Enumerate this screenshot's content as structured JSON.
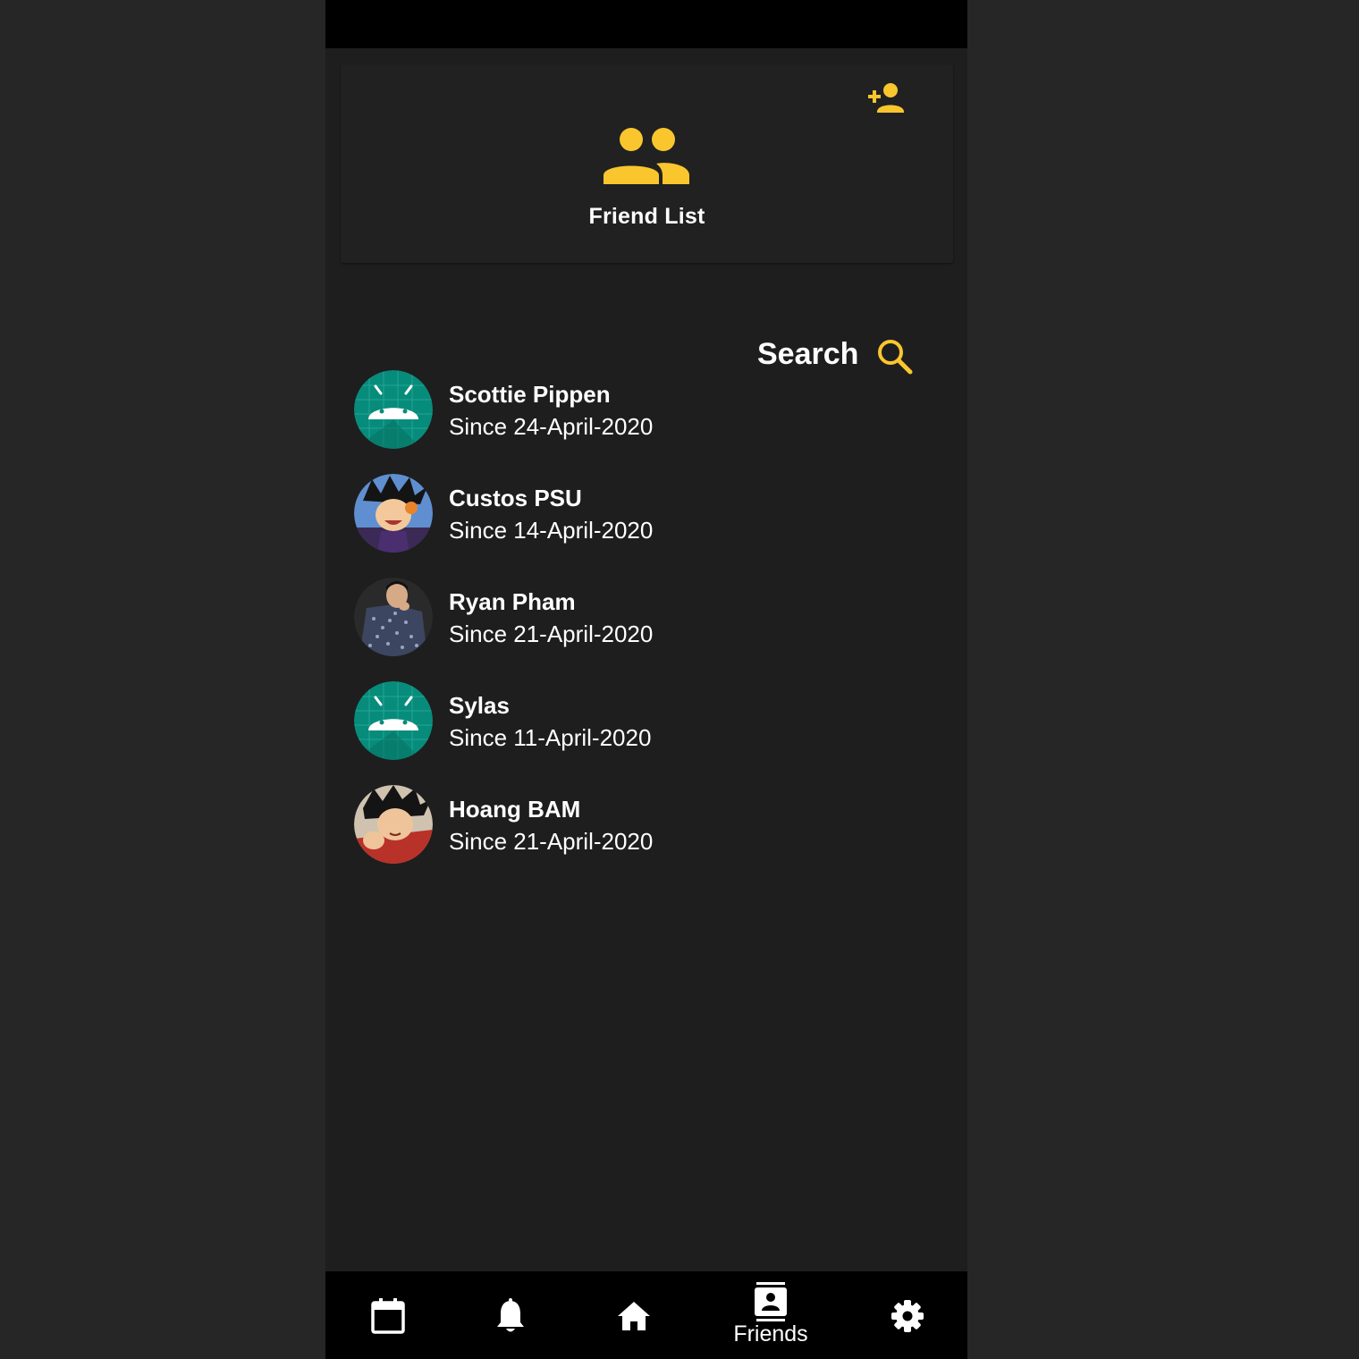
{
  "colors": {
    "accent": "#F9C62E",
    "background": "#1e1e1e",
    "card": "#212121",
    "nav_bar": "#000000",
    "android_avatar": "#078C7B"
  },
  "header": {
    "title": "Friend List",
    "icon": "group-icon",
    "action_icon": "person-add-icon"
  },
  "search": {
    "label": "Search",
    "icon": "search-icon"
  },
  "friends": [
    {
      "name": "Scottie Pippen",
      "since": "Since 24-April-2020",
      "avatar": "android-default-avatar"
    },
    {
      "name": "Custos PSU",
      "since": "Since 14-April-2020",
      "avatar": "photo-avatar"
    },
    {
      "name": "Ryan Pham",
      "since": "Since 21-April-2020",
      "avatar": "photo-avatar"
    },
    {
      "name": "Sylas",
      "since": "Since 11-April-2020",
      "avatar": "android-default-avatar"
    },
    {
      "name": "Hoang BAM",
      "since": "Since 21-April-2020",
      "avatar": "photo-avatar"
    }
  ],
  "nav": {
    "items": [
      {
        "icon": "calendar-icon",
        "label": ""
      },
      {
        "icon": "bell-icon",
        "label": ""
      },
      {
        "icon": "home-icon",
        "label": ""
      },
      {
        "icon": "contact-card-icon",
        "label": "Friends",
        "active": true
      },
      {
        "icon": "gear-icon",
        "label": ""
      }
    ]
  }
}
